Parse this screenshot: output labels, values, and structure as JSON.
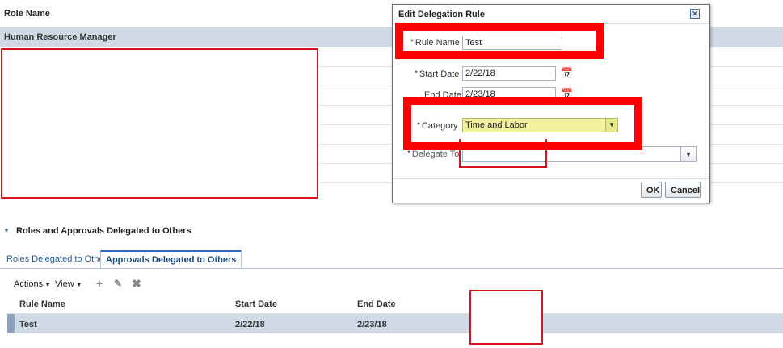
{
  "background_table": {
    "header": "Role Name",
    "rows": [
      "Human Resource Manager"
    ]
  },
  "section": {
    "title": "Roles and Approvals Delegated to Others",
    "tabs": [
      "Roles Delegated to Others",
      "Approvals Delegated to Others"
    ],
    "active_tab": "Approvals Delegated to Others",
    "toolbar": {
      "actions_label": "Actions",
      "view_label": "View",
      "icons": [
        "add-icon",
        "edit-icon",
        "delete-icon"
      ]
    },
    "table": {
      "columns": [
        "Rule Name",
        "Start Date",
        "End Date"
      ],
      "rows": [
        {
          "rule_name": "Test",
          "start_date": "2/22/18",
          "end_date": "2/23/18"
        }
      ]
    }
  },
  "dialog": {
    "title": "Edit Delegation Rule",
    "fields": {
      "rule_name": {
        "label": "Rule Name",
        "value": "Test",
        "required": "*"
      },
      "start_date": {
        "label": "Start Date",
        "value": "2/22/18",
        "required": "*"
      },
      "end_date": {
        "label": "End Date",
        "value": "2/23/18"
      },
      "category": {
        "label": "Category",
        "value": "Time and Labor",
        "required": "*"
      },
      "delegate_to": {
        "label": "Delegate To",
        "value": "",
        "required": "*"
      }
    },
    "buttons": {
      "ok": "OK",
      "cancel": "Cancel"
    }
  },
  "colors": {
    "annotation_red": "#ff0000",
    "row_highlight": "#cfdae6",
    "category_highlight": "#f1f1a0"
  }
}
